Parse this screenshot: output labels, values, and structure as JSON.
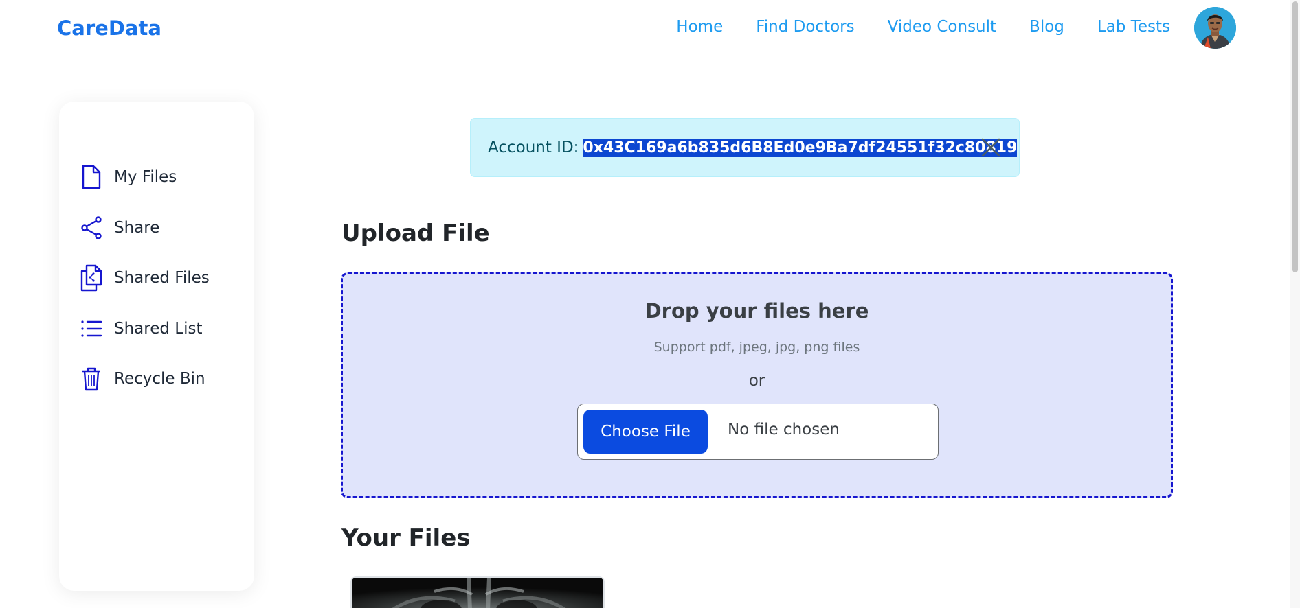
{
  "app": {
    "brand": "CareData"
  },
  "nav": {
    "links": [
      "Home",
      "Find Doctors",
      "Video Consult",
      "Blog",
      "Lab Tests"
    ]
  },
  "sidebar": {
    "items": [
      {
        "label": "My Files",
        "icon": "file-icon"
      },
      {
        "label": "Share",
        "icon": "share-icon"
      },
      {
        "label": "Shared Files",
        "icon": "shared-files-icon"
      },
      {
        "label": "Shared List",
        "icon": "list-icon"
      },
      {
        "label": "Recycle Bin",
        "icon": "trash-icon"
      }
    ]
  },
  "alert": {
    "label": "Account ID:",
    "account_id": "0x43C169a6b835d6B8Ed0e9Ba7df24551f32c80819"
  },
  "upload": {
    "title": "Upload File",
    "drop_title": "Drop your files here",
    "support": "Support pdf, jpeg, jpg, png files",
    "or": "or",
    "choose_label": "Choose File",
    "status": "No file chosen"
  },
  "files": {
    "title": "Your Files"
  },
  "colors": {
    "brand": "#1a73e8",
    "nav_link": "#1d9bf0",
    "accent": "#1616cf",
    "alert_bg": "#cff4fc",
    "dropzone_bg": "#e0e4fb",
    "button": "#0b4be0"
  }
}
